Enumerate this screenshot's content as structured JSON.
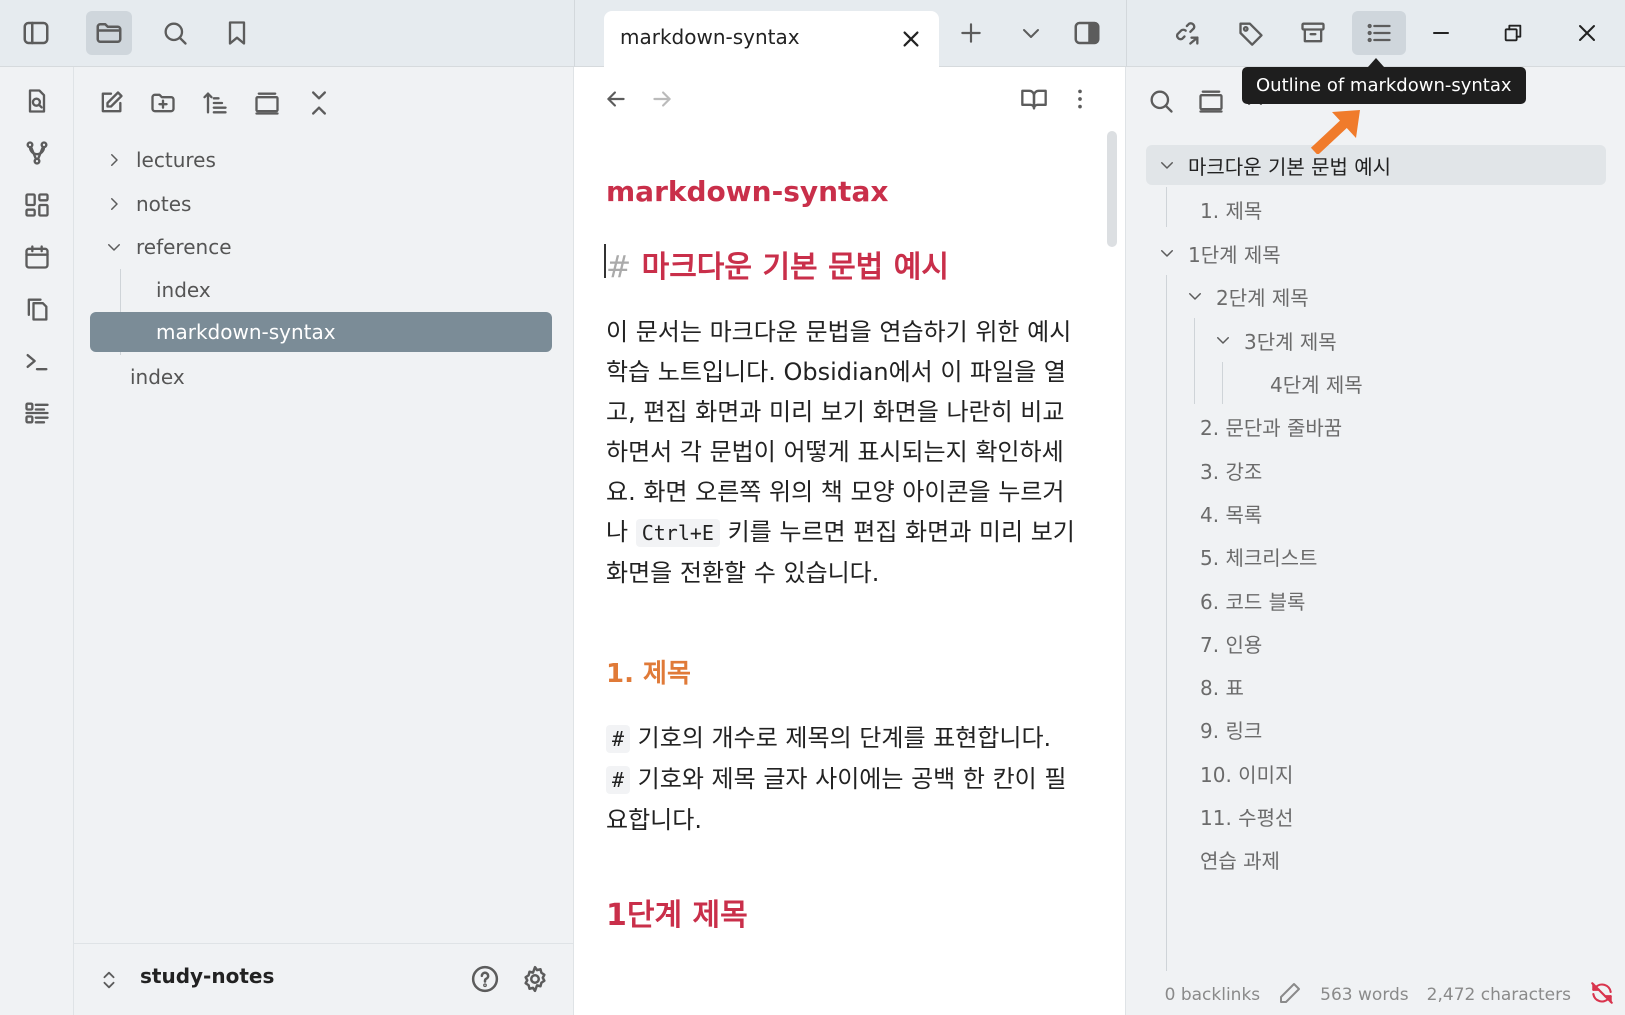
{
  "tab": {
    "title": "markdown-syntax"
  },
  "tooltip": {
    "text": "Outline of markdown-syntax"
  },
  "explorer": {
    "tree": [
      {
        "label": "lectures",
        "expanded": false
      },
      {
        "label": "notes",
        "expanded": false
      },
      {
        "label": "reference",
        "expanded": true
      },
      {
        "label": "index"
      },
      {
        "label": "markdown-syntax",
        "selected": true
      },
      {
        "label": "index"
      }
    ],
    "vault_name": "study-notes"
  },
  "editor": {
    "inline_title": "markdown-syntax",
    "h1_hash": "#",
    "h1_text": "마크다운 기본 문법 예시",
    "para1_before": "이 문서는 마크다운 문법을 연습하기 위한 예시 학습 노트입니다. Obsidian에서 이 파일을 열고, 편집 화면과 미리 보기 화면을 나란히 비교하면서 각 문법이 어떻게 표시되는지 확인하세요. 화면 오른쪽 위의 책 모양 아이콘을 누르거나 ",
    "para1_code": "Ctrl+E",
    "para1_after": " 키를 누르면 편집 화면과 미리 보기 화면을 전환할 수 있습니다.",
    "h2_1": "1. 제목",
    "para2_code1": "#",
    "para2_mid1": " 기호의 개수로 제목의 단계를 표현합니다. ",
    "para2_code2": "#",
    "para2_mid2": " 기호와 제목 글자 사이에는 공백 한 칸이 필요합니다.",
    "h1_2": "1단계 제목"
  },
  "outline": {
    "items": [
      {
        "label": "마크다운 기본 문법 예시",
        "level": 0,
        "chev": true
      },
      {
        "label": "1. 제목",
        "level": 1
      },
      {
        "label": "1단계 제목",
        "level": 0,
        "chev": true
      },
      {
        "label": "2단계 제목",
        "level": 1,
        "chev": true
      },
      {
        "label": "3단계 제목",
        "level": 2,
        "chev": true
      },
      {
        "label": "4단계 제목",
        "level": 3
      },
      {
        "label": "2. 문단과 줄바꿈",
        "level": 1
      },
      {
        "label": "3. 강조",
        "level": 1
      },
      {
        "label": "4. 목록",
        "level": 1
      },
      {
        "label": "5. 체크리스트",
        "level": 1
      },
      {
        "label": "6. 코드 블록",
        "level": 1
      },
      {
        "label": "7. 인용",
        "level": 1
      },
      {
        "label": "8. 표",
        "level": 1
      },
      {
        "label": "9. 링크",
        "level": 1
      },
      {
        "label": "10. 이미지",
        "level": 1
      },
      {
        "label": "11. 수평선",
        "level": 1
      },
      {
        "label": "연습 과제",
        "level": 1
      }
    ]
  },
  "status": {
    "backlinks": "0 backlinks",
    "words": "563 words",
    "characters": "2,472 characters"
  },
  "colors": {
    "accent_heading": "#c92f4a",
    "accent_h2": "#e07a38",
    "selected_bg": "#7b8c97",
    "annotation_arrow": "#f07b2b"
  }
}
